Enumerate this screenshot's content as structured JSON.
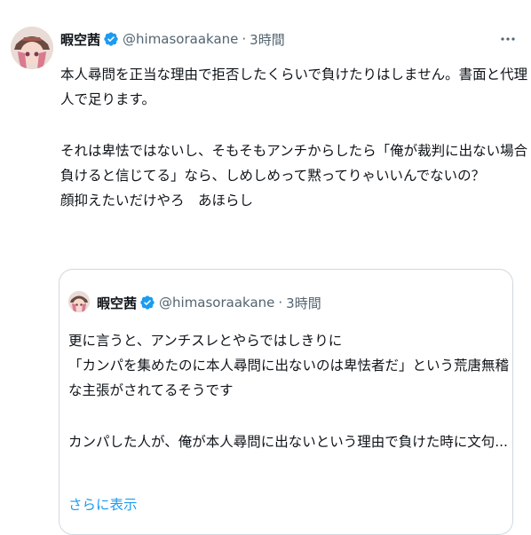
{
  "tweet": {
    "display_name": "暇空茜",
    "handle": "@himasoraakane",
    "separator": "·",
    "time": "3時間",
    "avatar_icon": "user-avatar-image",
    "verified_icon": "verified-badge-icon",
    "more_icon": "more-options-icon",
    "body_lines": [
      "本人尋問を正当な理由で拒否したくらいで負けたりはしません。書面と代理",
      "人で足ります。",
      "",
      "それは卑怯ではないし、そもそもアンチからしたら「俺が裁判に出ない場合",
      "負けると信じてる」なら、しめしめって黙ってりゃいいんでないの？",
      "顔抑えたいだけやろ　あほらし"
    ]
  },
  "quote": {
    "display_name": "暇空茜",
    "handle": "@himasoraakane",
    "separator": "·",
    "time": "3時間",
    "body_lines": [
      "更に言うと、アンチスレとやらではしきりに",
      "「カンパを集めたのに本人尋問に出ないのは卑怯者だ」という荒唐無稽",
      "な主張がされてるそうです",
      "",
      "カンパした人が、俺が本人尋問に出ないという理由で負けた時に文句..."
    ],
    "show_more": "さらに表示"
  },
  "colors": {
    "text": "#0f1419",
    "secondary": "#536471",
    "link": "#1d9bf0",
    "border": "#cfd9de",
    "verified": "#1d9bf0"
  }
}
